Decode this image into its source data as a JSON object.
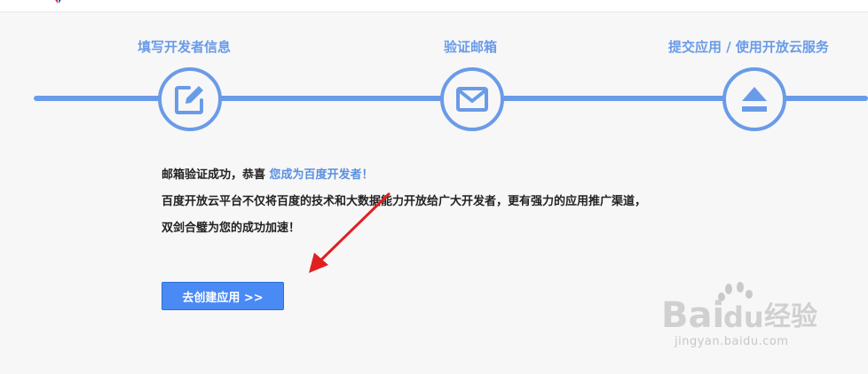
{
  "steps": [
    {
      "label": "填写开发者信息",
      "icon": "edit-icon"
    },
    {
      "label": "验证邮箱",
      "icon": "mail-icon"
    },
    {
      "label": "提交应用 / 使用开放云服务",
      "icon": "upload-icon"
    }
  ],
  "message": {
    "line1_prefix": "邮箱验证成功，恭喜",
    "line1_highlight": "您成为百度开发者！",
    "line2": "百度开放云平台不仅将百度的技术和大数据能力开放给广大开发者，更有强力的应用推广渠道，",
    "line3": "双剑合璧为您的成功加速！"
  },
  "cta_label": "去创建应用 >>",
  "watermark": {
    "brand_latin": "Bai",
    "brand_du": "du",
    "brand_cn": "经验",
    "url": "jingyan.baidu.com"
  },
  "colors": {
    "accent": "#6a9be8",
    "button": "#4a8af4",
    "highlight": "#5b8fe0",
    "annotation_arrow": "#e02020"
  }
}
